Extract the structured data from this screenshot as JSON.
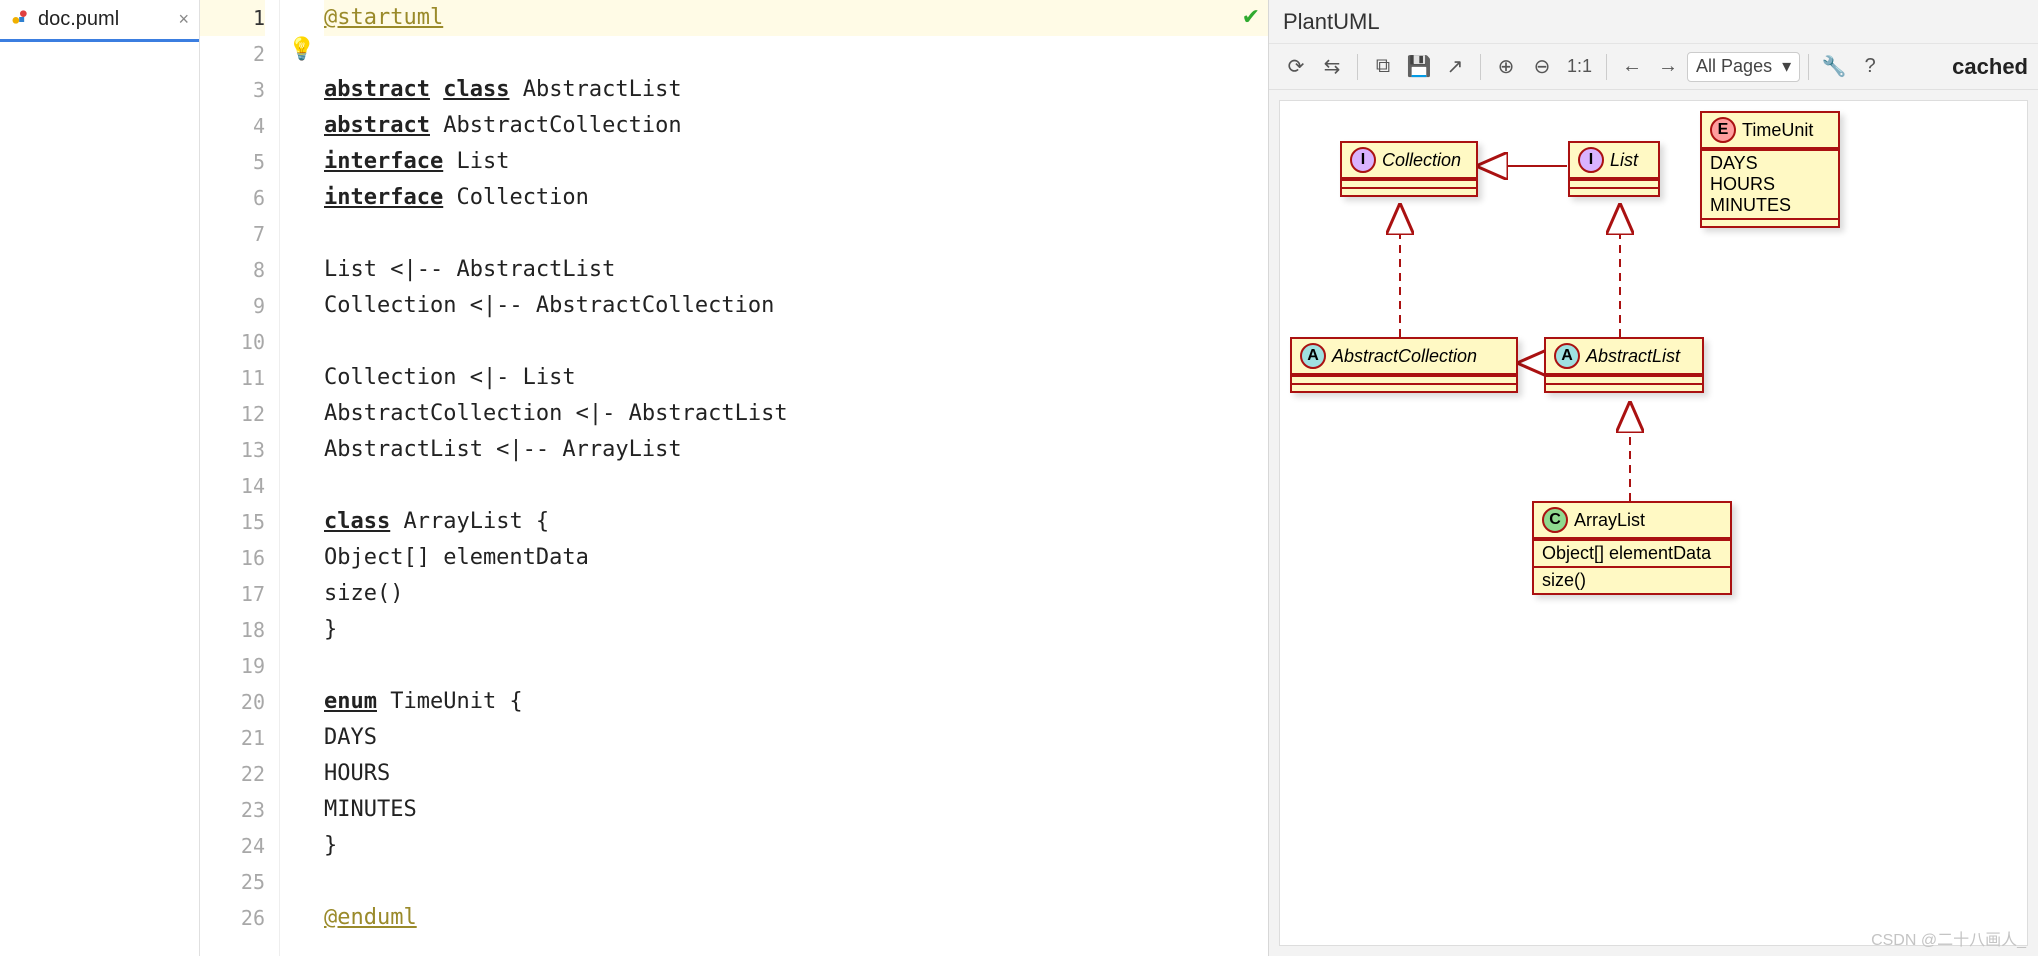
{
  "tab": {
    "filename": "doc.puml"
  },
  "editor": {
    "lines": [
      {
        "n": 1,
        "current": true,
        "html": "<span class='dir'>@startuml</span>"
      },
      {
        "n": 2,
        "html": ""
      },
      {
        "n": 3,
        "html": "<span class='kw'>abstract</span> <span class='kw'>class</span> AbstractList"
      },
      {
        "n": 4,
        "html": "<span class='kw'>abstract</span> AbstractCollection"
      },
      {
        "n": 5,
        "html": "<span class='kw'>interface</span> List"
      },
      {
        "n": 6,
        "html": "<span class='kw'>interface</span> Collection"
      },
      {
        "n": 7,
        "html": ""
      },
      {
        "n": 8,
        "html": "List <|-- AbstractList"
      },
      {
        "n": 9,
        "html": "Collection <|-- AbstractCollection"
      },
      {
        "n": 10,
        "html": ""
      },
      {
        "n": 11,
        "html": "Collection <|- List"
      },
      {
        "n": 12,
        "html": "AbstractCollection <|- AbstractList"
      },
      {
        "n": 13,
        "html": "AbstractList <|-- ArrayList"
      },
      {
        "n": 14,
        "html": ""
      },
      {
        "n": 15,
        "html": "<span class='kw'>class</span> ArrayList {"
      },
      {
        "n": 16,
        "html": "Object[] elementData"
      },
      {
        "n": 17,
        "html": "size()"
      },
      {
        "n": 18,
        "html": "}"
      },
      {
        "n": 19,
        "html": ""
      },
      {
        "n": 20,
        "html": "<span class='kw'>enum</span> TimeUnit {"
      },
      {
        "n": 21,
        "html": "DAYS"
      },
      {
        "n": 22,
        "html": "HOURS"
      },
      {
        "n": 23,
        "html": "MINUTES"
      },
      {
        "n": 24,
        "html": "}"
      },
      {
        "n": 25,
        "html": ""
      },
      {
        "n": 26,
        "html": "<span class='dir'>@enduml</span>"
      }
    ]
  },
  "preview": {
    "title": "PlantUML",
    "pager": "All Pages",
    "zoom11": "1:1",
    "status": "cached"
  },
  "uml": {
    "collection": {
      "label": "Collection",
      "badge": "I"
    },
    "list": {
      "label": "List",
      "badge": "I"
    },
    "abscoll": {
      "label": "AbstractCollection",
      "badge": "A"
    },
    "abslist": {
      "label": "AbstractList",
      "badge": "A"
    },
    "arraylist": {
      "label": "ArrayList",
      "badge": "C",
      "attr": "Object[] elementData",
      "op": "size()"
    },
    "timeunit": {
      "label": "TimeUnit",
      "badge": "E",
      "items": [
        "DAYS",
        "HOURS",
        "MINUTES"
      ]
    }
  },
  "watermark": "CSDN @二十八画人_"
}
